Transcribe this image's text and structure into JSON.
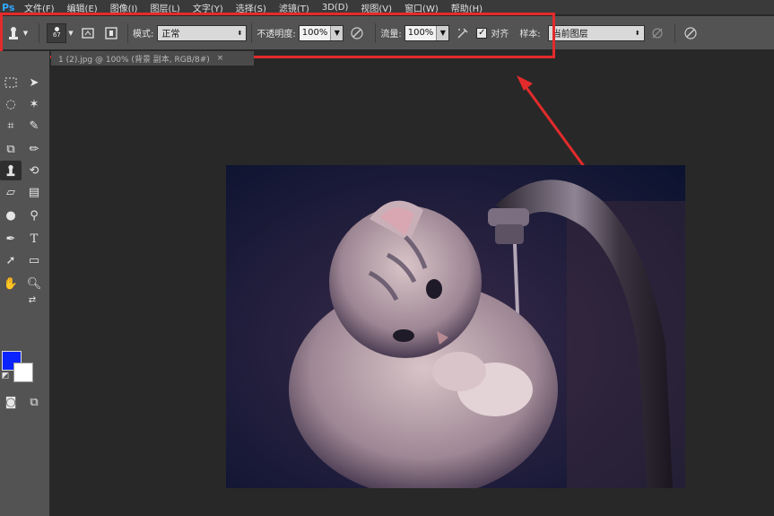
{
  "app": {
    "logo": "Ps"
  },
  "menu": [
    "文件(F)",
    "编辑(E)",
    "图像(I)",
    "图层(L)",
    "文字(Y)",
    "选择(S)",
    "滤镜(T)",
    "3D(D)",
    "视图(V)",
    "窗口(W)",
    "帮助(H)"
  ],
  "options": {
    "brush_size": "67",
    "mode_label": "模式:",
    "mode_value": "正常",
    "opacity_label": "不透明度:",
    "opacity_value": "100%",
    "flow_label": "流量:",
    "flow_value": "100%",
    "aligned_label": "对齐",
    "aligned_checked": true,
    "sample_label": "样本:",
    "sample_value": "当前图层"
  },
  "document": {
    "tab_title": "1 (2).jpg @ 100% (背景 副本, RGB/8#)"
  },
  "colors": {
    "foreground": "#0a23ff",
    "background": "#ffffff",
    "highlight": "#e32b2b"
  },
  "annotation": {
    "type": "red-arrow",
    "target": "options-bar"
  },
  "image": {
    "subject": "kitten pawing at water from a faucet"
  }
}
